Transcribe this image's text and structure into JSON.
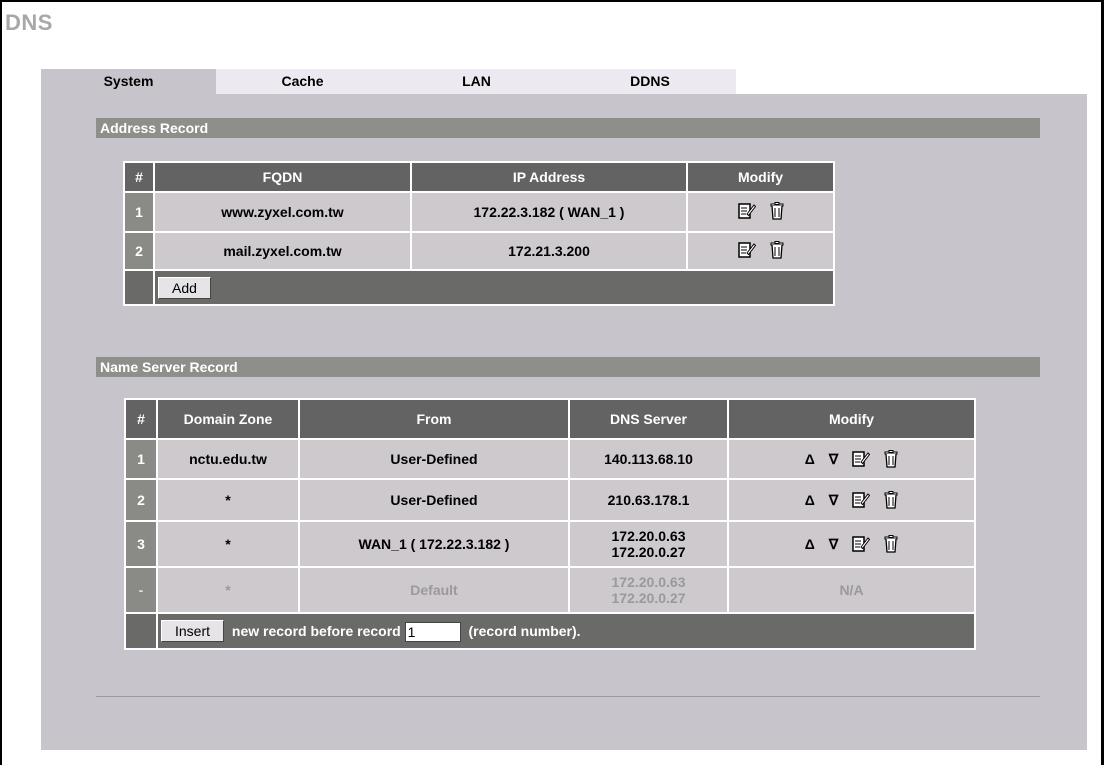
{
  "title": "DNS",
  "tabs": [
    {
      "label": "System",
      "active": true
    },
    {
      "label": "Cache",
      "active": false
    },
    {
      "label": "LAN",
      "active": false
    },
    {
      "label": "DDNS",
      "active": false
    }
  ],
  "address_record": {
    "section_title": "Address Record",
    "headers": [
      "#",
      "FQDN",
      "IP Address",
      "Modify"
    ],
    "rows": [
      {
        "num": "1",
        "fqdn": "www.zyxel.com.tw",
        "ip": "172.22.3.182 ( WAN_1 )"
      },
      {
        "num": "2",
        "fqdn": "mail.zyxel.com.tw",
        "ip": "172.21.3.200"
      }
    ],
    "add_label": "Add"
  },
  "name_server_record": {
    "section_title": "Name Server Record",
    "headers": [
      "#",
      "Domain Zone",
      "From",
      "DNS Server",
      "Modify"
    ],
    "rows": [
      {
        "num": "1",
        "zone": "nctu.edu.tw",
        "from": "User-Defined",
        "dns1": "140.113.68.10",
        "dns2": ""
      },
      {
        "num": "2",
        "zone": "*",
        "from": "User-Defined",
        "dns1": "210.63.178.1",
        "dns2": ""
      },
      {
        "num": "3",
        "zone": "*",
        "from": "WAN_1 ( 172.22.3.182 )",
        "dns1": "172.20.0.63",
        "dns2": "172.20.0.27"
      }
    ],
    "default_row": {
      "num": "-",
      "zone": "*",
      "from": "Default",
      "dns1": "172.20.0.63",
      "dns2": "172.20.0.27",
      "modify": "N/A"
    },
    "insert_label": "Insert",
    "insert_text_before": "new record before record",
    "insert_value": "1",
    "insert_text_after": "(record number)."
  },
  "colors": {
    "panel": "#c8c4cc",
    "header": "#636363",
    "section": "#8e8e8a"
  }
}
